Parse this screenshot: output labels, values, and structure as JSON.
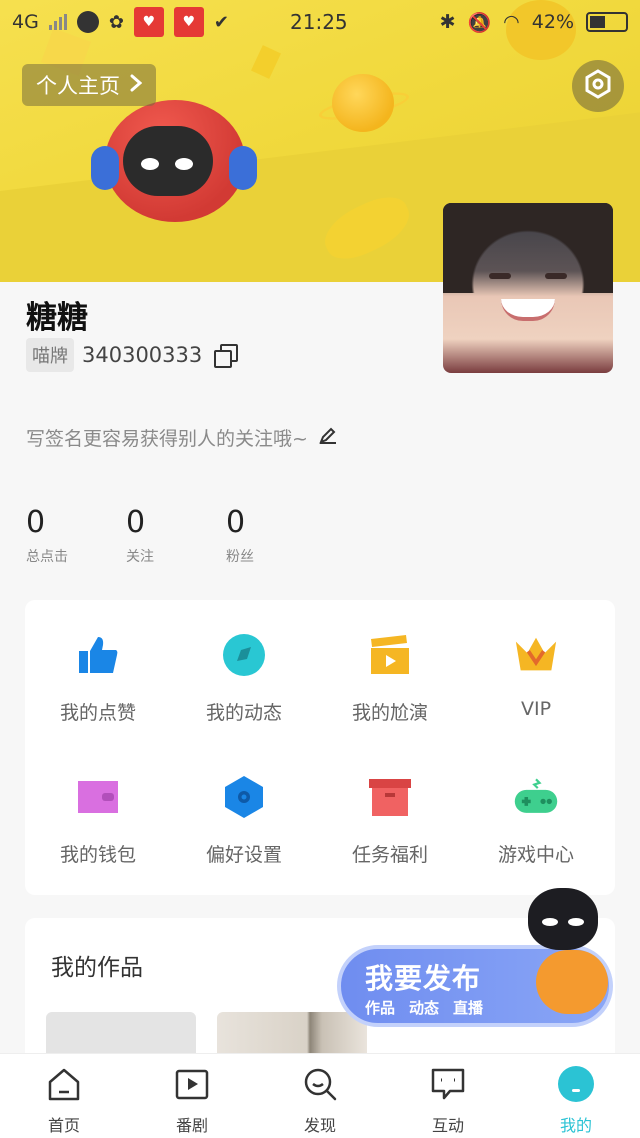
{
  "status_bar": {
    "network": "4G",
    "time": "21:25",
    "battery": "42%"
  },
  "header": {
    "profile_button_label": "个人主页",
    "settings_icon": "hexagon-settings-icon"
  },
  "profile": {
    "name": "糖糖",
    "tag_label": "喵牌",
    "user_id": "340300333",
    "signature": "写签名更容易获得别人的关注哦~"
  },
  "stats": [
    {
      "value": "0",
      "label": "总点击"
    },
    {
      "value": "0",
      "label": "关注"
    },
    {
      "value": "0",
      "label": "粉丝"
    }
  ],
  "menu": [
    {
      "label": "我的点赞",
      "icon": "thumbs-up-icon",
      "color": "#1a86e6"
    },
    {
      "label": "我的动态",
      "icon": "dynamic-icon",
      "color": "#29c7d3"
    },
    {
      "label": "我的尬演",
      "icon": "clapper-icon",
      "color": "#f5b623"
    },
    {
      "label": "VIP",
      "icon": "crown-icon",
      "color": "#f5b623"
    },
    {
      "label": "我的钱包",
      "icon": "wallet-icon",
      "color": "#d96fe0"
    },
    {
      "label": "偏好设置",
      "icon": "hexagon-gear-icon",
      "color": "#1a86e6"
    },
    {
      "label": "任务福利",
      "icon": "gift-box-icon",
      "color": "#f06262"
    },
    {
      "label": "游戏中心",
      "icon": "gamepad-icon",
      "color": "#3ecf8e"
    }
  ],
  "works": {
    "title": "我的作品"
  },
  "publish": {
    "title": "我要发布",
    "options": [
      "作品",
      "动态",
      "直播"
    ]
  },
  "tabs": [
    {
      "label": "首页",
      "icon": "home-icon"
    },
    {
      "label": "番剧",
      "icon": "play-icon"
    },
    {
      "label": "发现",
      "icon": "discover-icon"
    },
    {
      "label": "互动",
      "icon": "chat-icon"
    },
    {
      "label": "我的",
      "icon": "profile-icon"
    }
  ],
  "colors": {
    "accent": "#2bc3d4",
    "banner": "#f2d83c"
  }
}
